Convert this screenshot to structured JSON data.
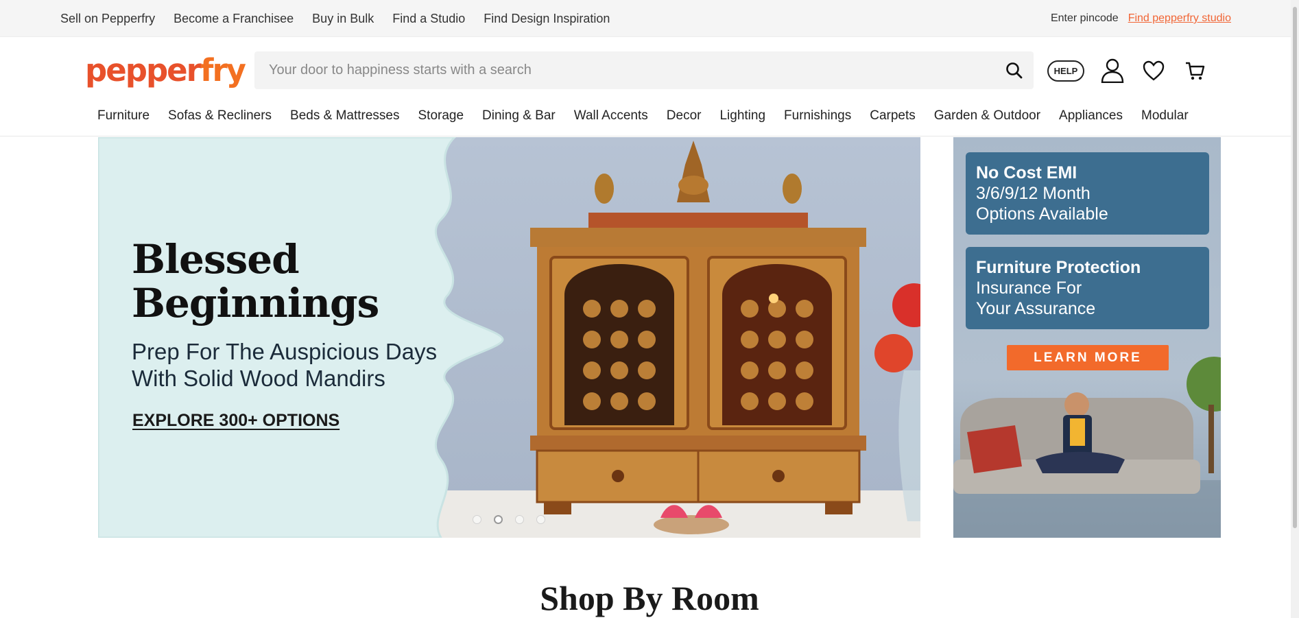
{
  "topbar": {
    "links": [
      "Sell on Pepperfry",
      "Become a Franchisee",
      "Buy in Bulk",
      "Find a Studio",
      "Find Design Inspiration"
    ],
    "pincode_label": "Enter pincode",
    "studio_link": "Find pepperfry studio"
  },
  "header": {
    "logo_main": "pepper",
    "logo_accent": "fry",
    "search_placeholder": "Your door to happiness starts with a search",
    "help_label": "HELP",
    "icons": [
      "search-icon",
      "user-icon",
      "heart-icon",
      "cart-icon"
    ]
  },
  "nav": {
    "categories": [
      "Furniture",
      "Sofas & Recliners",
      "Beds & Mattresses",
      "Storage",
      "Dining & Bar",
      "Wall Accents",
      "Decor",
      "Lighting",
      "Furnishings",
      "Carpets",
      "Garden & Outdoor",
      "Appliances",
      "Modular"
    ]
  },
  "hero": {
    "title_line1": "Blessed",
    "title_line2": "Beginnings",
    "sub_line1": "Prep For The Auspicious Days",
    "sub_line2": "With Solid Wood Mandirs",
    "cta": "EXPLORE 300+ OPTIONS",
    "slide_count": 4,
    "active_slide": 2
  },
  "side_ad": {
    "counter": "2 of 4",
    "card1_heading": "No Cost EMI",
    "card1_line1": "3/6/9/12 Month",
    "card1_line2": "Options Available",
    "card2_heading": "Furniture Protection",
    "card2_line1": "Insurance For",
    "card2_line2": "Your Assurance",
    "button": "LEARN MORE"
  },
  "section": {
    "title": "Shop By Room"
  },
  "colors": {
    "brand": "#e8512b",
    "brand_accent": "#f37021",
    "link": "#f16535",
    "card_blue": "#3d6e90",
    "cta_orange": "#f26a2b"
  }
}
